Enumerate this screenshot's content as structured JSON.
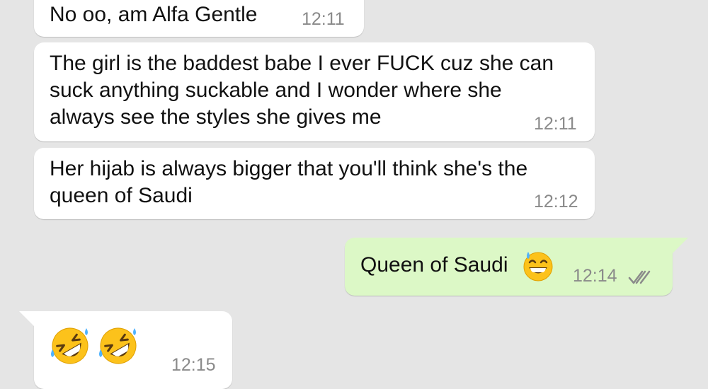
{
  "messages": [
    {
      "direction": "incoming",
      "text": "No oo, am Alfa Gentle",
      "time": "12:11"
    },
    {
      "direction": "incoming",
      "text": "The girl is the baddest babe I ever FUCK cuz she can suck anything suckable and I wonder where she always see the styles she gives me",
      "time": "12:11"
    },
    {
      "direction": "incoming",
      "text": "Her hijab is always bigger that you'll think she's the queen of Saudi",
      "time": "12:12"
    },
    {
      "direction": "outgoing",
      "text": "Queen of Saudi",
      "emoji": "grinning-sweat-emoji",
      "time": "12:14",
      "status": "read-double-check-icon"
    },
    {
      "direction": "incoming",
      "emojis": [
        "rolling-on-floor-laughing-emoji",
        "rolling-on-floor-laughing-emoji"
      ],
      "time": "12:15"
    }
  ],
  "colors": {
    "background": "#e5e5e5",
    "incoming_bubble": "#ffffff",
    "outgoing_bubble": "#dcf8c6",
    "timestamp": "#8a8a8a",
    "tick_read": "#8a8a8a"
  }
}
